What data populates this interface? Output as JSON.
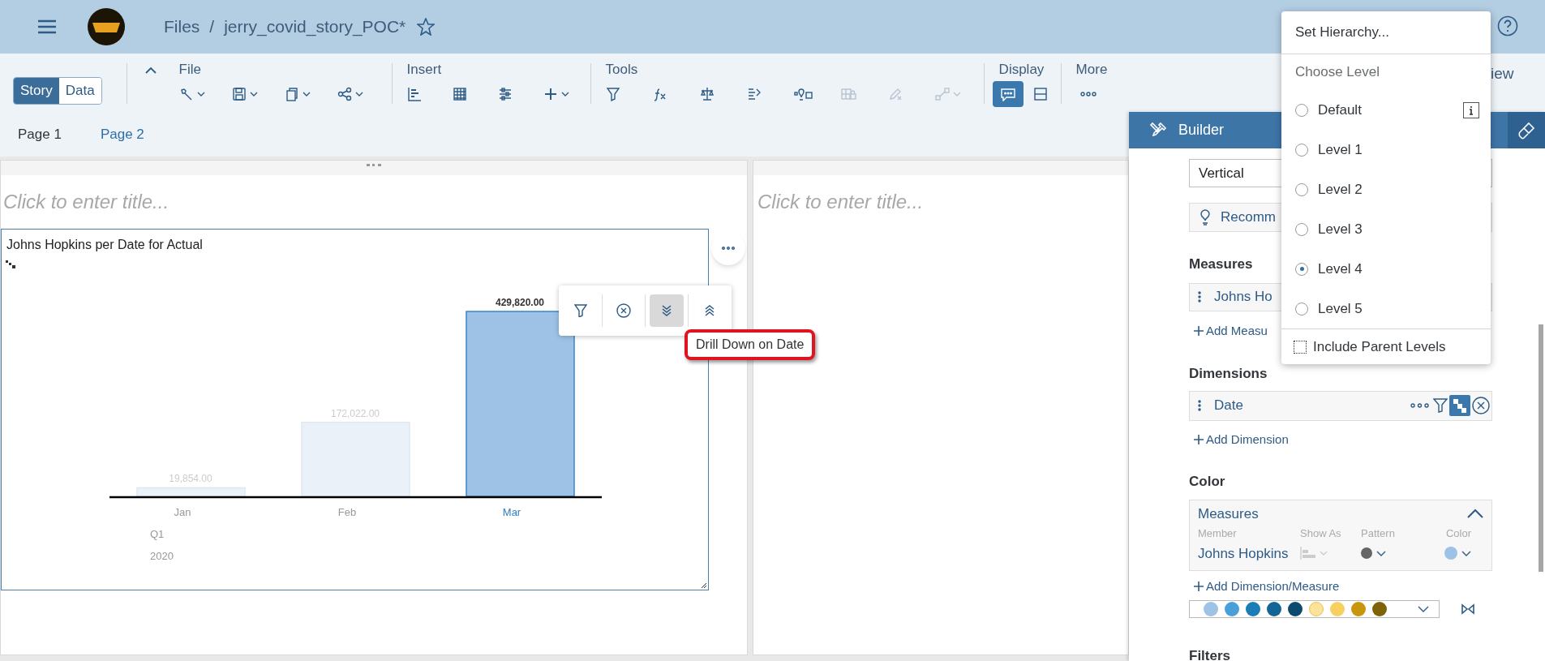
{
  "header": {
    "breadcrumb_root": "Files",
    "separator": "/",
    "file_name": "jerry_covid_story_POC*"
  },
  "mode_toggle": [
    {
      "label": "Story",
      "selected": true
    },
    {
      "label": "Data",
      "selected": false
    }
  ],
  "toolbar_groups": [
    {
      "label": "File",
      "buttons": [
        {
          "dropdown": true,
          "disabled": false
        },
        {
          "dropdown": true,
          "disabled": false
        },
        {
          "dropdown": true,
          "disabled": false
        },
        {
          "dropdown": true,
          "disabled": false
        }
      ]
    },
    {
      "label": "Insert",
      "buttons": [
        {
          "dropdown": false,
          "disabled": false
        },
        {
          "dropdown": false,
          "disabled": false
        },
        {
          "dropdown": false,
          "disabled": false
        },
        {
          "dropdown": true,
          "disabled": false
        }
      ]
    },
    {
      "label": "Tools",
      "buttons": [
        {
          "dropdown": false,
          "disabled": false
        },
        {
          "dropdown": false,
          "disabled": false
        },
        {
          "dropdown": false,
          "disabled": false
        },
        {
          "dropdown": false,
          "disabled": false
        },
        {
          "dropdown": false,
          "disabled": false
        },
        {
          "dropdown": false,
          "disabled": true
        },
        {
          "dropdown": false,
          "disabled": true
        },
        {
          "dropdown": true,
          "disabled": true
        }
      ]
    },
    {
      "label": "Display",
      "buttons": [
        {
          "active": true
        },
        {
          "active": false
        }
      ]
    },
    {
      "label": "More",
      "buttons": [
        {
          "active": false
        }
      ]
    }
  ],
  "toolbar_right_text": "iew",
  "pages": [
    {
      "label": "Page 1",
      "selected": true
    },
    {
      "label": "Page 2",
      "selected": false
    }
  ],
  "left_panel": {
    "title_placeholder": "Click to enter title...",
    "chart": {
      "title": "Johns Hopkins per Date for Actual",
      "sub_labels": [
        "Q1",
        "2020"
      ],
      "bar_states": [
        {
          "selected": false
        },
        {
          "selected": false
        },
        {
          "selected": true
        }
      ],
      "chart_data": {
        "type": "bar",
        "categories": [
          "Jan",
          "Feb",
          "Mar"
        ],
        "values": [
          19854,
          172022,
          429820
        ],
        "value_labels": [
          "19,854.00",
          "172,022.00",
          "429,820.00"
        ]
      }
    },
    "context_toolbar": [
      {
        "selected": false
      },
      {
        "selected": false
      },
      {
        "selected": true
      },
      {
        "selected": false
      }
    ],
    "tooltip": {
      "text": "Drill Down on Date",
      "annotated": true
    }
  },
  "right_panel": {
    "title_placeholder": "Click to enter title..."
  },
  "builder": {
    "title": "Builder",
    "orientation": "Vertical",
    "recommend": "Recomm",
    "measures_heading": "Measures",
    "measure_item": "Johns Ho",
    "add_measure": "Add Measu",
    "dimensions_heading": "Dimensions",
    "dimension_item": "Date",
    "add_dimension": "Add Dimension",
    "color_heading": "Color",
    "color_box": {
      "title": "Measures",
      "expanded": true,
      "columns": [
        "Member",
        "Show As",
        "Pattern",
        "Color"
      ],
      "member": "Johns Hopkins",
      "color": "#9ec2e6"
    },
    "add_dimension_measure": "Add Dimension/Measure",
    "palette": [
      {
        "color": "#9fc3e6"
      },
      {
        "color": "#4a9fd8"
      },
      {
        "color": "#1b7db5"
      },
      {
        "color": "#136596"
      },
      {
        "color": "#0d4a6e"
      },
      {
        "color": "#fde39a"
      },
      {
        "color": "#f8d060"
      },
      {
        "color": "#c8960a"
      },
      {
        "color": "#7e6208"
      }
    ],
    "filters_heading": "Filters"
  },
  "hierarchy_menu": {
    "title": "Set Hierarchy...",
    "section": "Choose Level",
    "options": [
      {
        "label": "Default",
        "selected": false,
        "info": true
      },
      {
        "label": "Level 1",
        "selected": false,
        "info": false
      },
      {
        "label": "Level 2",
        "selected": false,
        "info": false
      },
      {
        "label": "Level 3",
        "selected": false,
        "info": false
      },
      {
        "label": "Level 4",
        "selected": true,
        "info": false
      },
      {
        "label": "Level 5",
        "selected": false,
        "info": false
      }
    ],
    "checkbox": {
      "label": "Include Parent Levels",
      "checked": false
    }
  }
}
